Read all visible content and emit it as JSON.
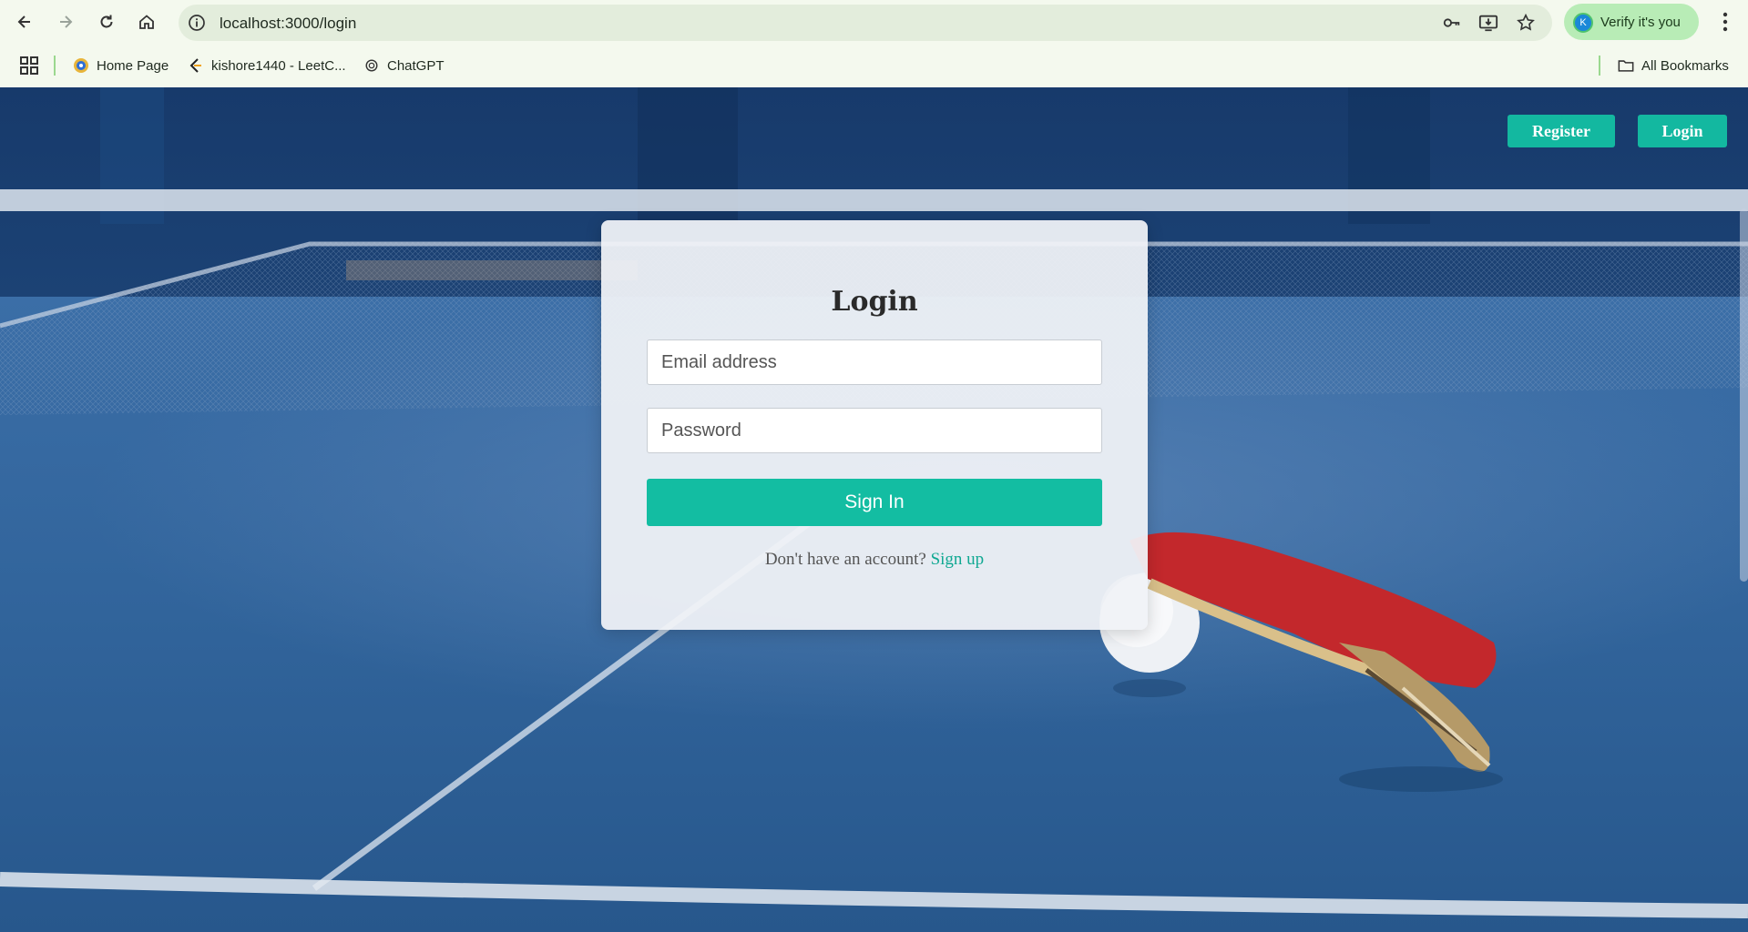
{
  "browser": {
    "url": "localhost:3000/login",
    "verify_label": "Verify it's you",
    "avatar_letter": "K",
    "bookmarks": [
      {
        "label": "Home Page",
        "icon": "home-page-favicon"
      },
      {
        "label": "kishore1440 - LeetC...",
        "icon": "leetcode-favicon"
      },
      {
        "label": "ChatGPT",
        "icon": "chatgpt-favicon"
      }
    ],
    "all_bookmarks_label": "All Bookmarks"
  },
  "header": {
    "register_label": "Register",
    "login_label": "Login"
  },
  "login_card": {
    "title": "Login",
    "email_placeholder": "Email address",
    "password_placeholder": "Password",
    "submit_label": "Sign In",
    "prompt_text": "Don't have an account? ",
    "signup_link": "Sign up"
  },
  "colors": {
    "accent": "#13b8a0",
    "chrome_bg": "#f4f9ee",
    "table_blue": "#2f5f96"
  }
}
